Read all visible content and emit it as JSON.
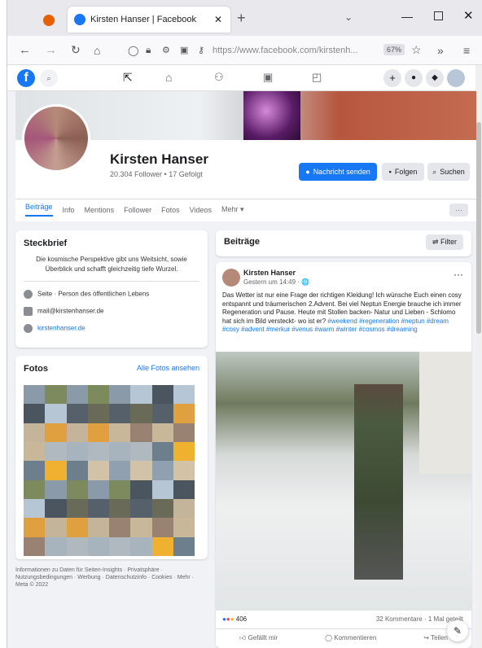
{
  "browser": {
    "tab_title": "Kirsten Hanser | Facebook",
    "url": "https://www.facebook.com/kirstenh...",
    "zoom": "67%"
  },
  "profile": {
    "name": "Kirsten Hanser",
    "followers": "20.304 Follower • 17 Gefolgt",
    "message_button": "Nachricht senden",
    "follow_button": "Folgen",
    "search_button": "Suchen"
  },
  "tabs": [
    "Beiträge",
    "Info",
    "Mentions",
    "Follower",
    "Fotos",
    "Videos",
    "Mehr ▾"
  ],
  "intro": {
    "title": "Steckbrief",
    "bio": "Die kosmische Perspektive gibt uns Weitsicht, sowie Überblick und schafft gleichzeitig tiefe Wurzel.",
    "category": "Seite · Person des öffentlichen Lebens",
    "email": "mail@kirstenhanser.de",
    "website": "kirstenhanser.de"
  },
  "photos": {
    "title": "Fotos",
    "see_all": "Alle Fotos ansehen"
  },
  "footer": "Informationen zu Daten für Seiten-Insights · Privatsphäre · Nutzungsbedingungen · Werbung · Datenschutzinfo · Cookies · Mehr · Meta © 2022",
  "posts": {
    "title": "Beiträge",
    "filter": "Filter",
    "author": "Kirsten Hanser",
    "time": "Gestern um 14:49 · 🌐",
    "text": "Das Wetter ist nur eine Frage der richtigen Kleidung! Ich wünsche Euch einen cosy entspannt und träumerischen 2.Advent. Bei viel Neptun Energie brauche ich immer Regeneration und Pause. Heute mit Stollen backen- Natur und Lieben - Schlomo hat sich im Bild versteckt- wo ist er?",
    "hashtags": "#weekend #regeneration #neptun #dream #cosy #advent #merkur #venus #warm #winter #cosmos #dreaming",
    "reactions": "406",
    "comments": "32 Kommentare · 1 Mal geteilt",
    "like": "Gefällt mir",
    "comment": "Kommentieren",
    "share": "Teilen"
  }
}
